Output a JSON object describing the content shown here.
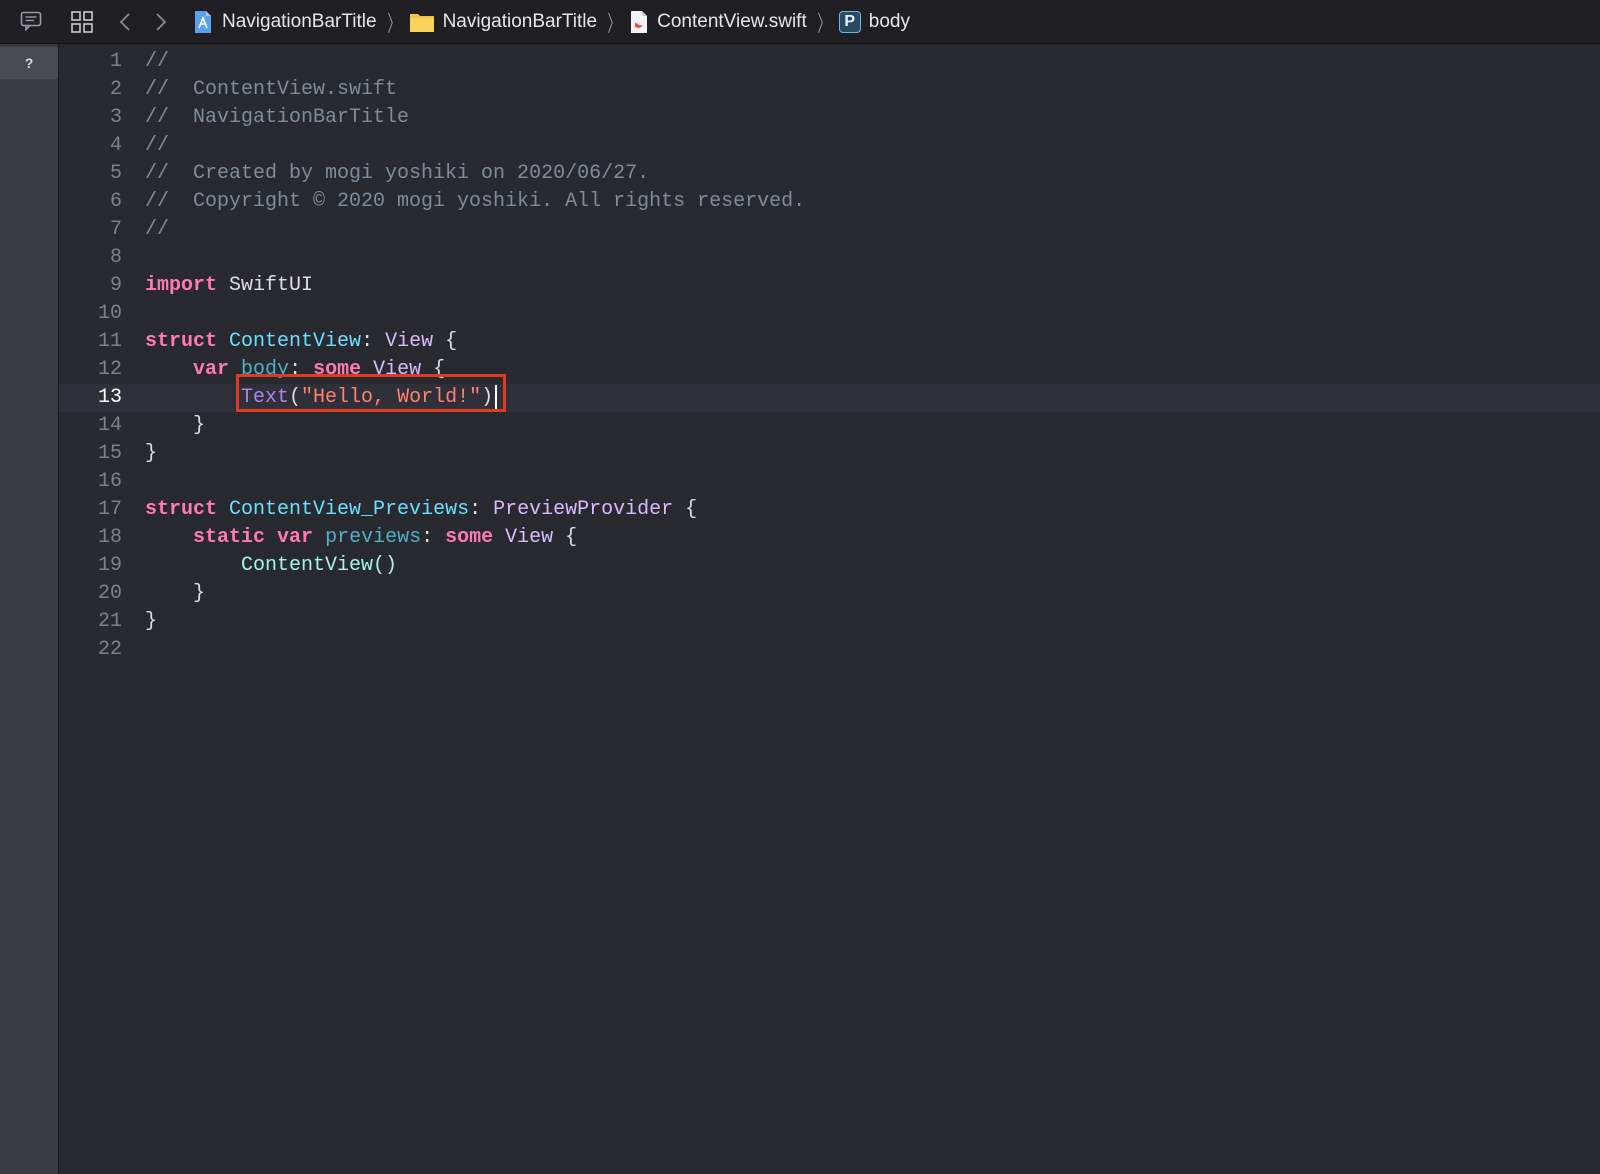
{
  "toolbar": {
    "breadcrumbs": [
      {
        "label": "NavigationBarTitle",
        "icon": "project-icon"
      },
      {
        "label": "NavigationBarTitle",
        "icon": "folder-icon"
      },
      {
        "label": "ContentView.swift",
        "icon": "swift-file-icon"
      },
      {
        "label": "body",
        "icon": "property-icon",
        "badge": "P"
      }
    ]
  },
  "sidebar": {
    "help_label": "?"
  },
  "editor": {
    "lines": [
      {
        "n": "1"
      },
      {
        "n": "2"
      },
      {
        "n": "3"
      },
      {
        "n": "4"
      },
      {
        "n": "5"
      },
      {
        "n": "6"
      },
      {
        "n": "7"
      },
      {
        "n": "8"
      },
      {
        "n": "9"
      },
      {
        "n": "10"
      },
      {
        "n": "11"
      },
      {
        "n": "12"
      },
      {
        "n": "13"
      },
      {
        "n": "14"
      },
      {
        "n": "15"
      },
      {
        "n": "16"
      },
      {
        "n": "17"
      },
      {
        "n": "18"
      },
      {
        "n": "19"
      },
      {
        "n": "20"
      },
      {
        "n": "21"
      },
      {
        "n": "22"
      }
    ],
    "current_line": "13",
    "code": {
      "c1": "//",
      "c2": "//  ContentView.swift",
      "c3": "//  NavigationBarTitle",
      "c4": "//",
      "c5": "//  Created by mogi yoshiki on 2020/06/27.",
      "c6": "//  Copyright © 2020 mogi yoshiki. All rights reserved.",
      "c7": "//",
      "kw_import": "import",
      "swiftui": " SwiftUI",
      "kw_struct": "struct",
      "contentview": "ContentView",
      "colon": ": ",
      "view": "View",
      "brace_open": " {",
      "kw_var": "var",
      "body": "body",
      "kw_some": "some",
      "text_fn": "Text",
      "paren_open": "(",
      "hello": "\"Hello, World!\"",
      "paren_close": ")",
      "brace_close": "}",
      "previews_struct": "ContentView_Previews",
      "preview_provider": "PreviewProvider",
      "kw_static": "static",
      "previews": "previews",
      "contentview_call": "ContentView()"
    }
  },
  "colors": {
    "highlight_box": "#e03a22",
    "keyword": "#ff7ab2",
    "comment": "#7f8c98",
    "string": "#ff8170"
  }
}
